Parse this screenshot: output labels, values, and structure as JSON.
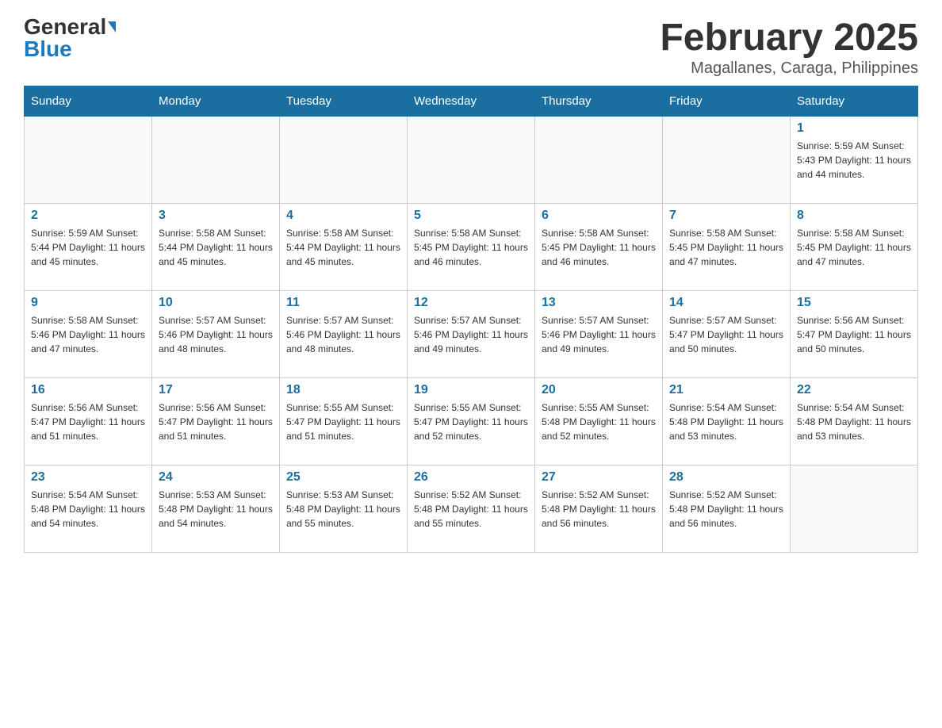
{
  "logo": {
    "general": "General",
    "blue": "Blue"
  },
  "title": {
    "month": "February 2025",
    "location": "Magallanes, Caraga, Philippines"
  },
  "headers": [
    "Sunday",
    "Monday",
    "Tuesday",
    "Wednesday",
    "Thursday",
    "Friday",
    "Saturday"
  ],
  "weeks": [
    [
      {
        "day": "",
        "info": ""
      },
      {
        "day": "",
        "info": ""
      },
      {
        "day": "",
        "info": ""
      },
      {
        "day": "",
        "info": ""
      },
      {
        "day": "",
        "info": ""
      },
      {
        "day": "",
        "info": ""
      },
      {
        "day": "1",
        "info": "Sunrise: 5:59 AM\nSunset: 5:43 PM\nDaylight: 11 hours and 44 minutes."
      }
    ],
    [
      {
        "day": "2",
        "info": "Sunrise: 5:59 AM\nSunset: 5:44 PM\nDaylight: 11 hours and 45 minutes."
      },
      {
        "day": "3",
        "info": "Sunrise: 5:58 AM\nSunset: 5:44 PM\nDaylight: 11 hours and 45 minutes."
      },
      {
        "day": "4",
        "info": "Sunrise: 5:58 AM\nSunset: 5:44 PM\nDaylight: 11 hours and 45 minutes."
      },
      {
        "day": "5",
        "info": "Sunrise: 5:58 AM\nSunset: 5:45 PM\nDaylight: 11 hours and 46 minutes."
      },
      {
        "day": "6",
        "info": "Sunrise: 5:58 AM\nSunset: 5:45 PM\nDaylight: 11 hours and 46 minutes."
      },
      {
        "day": "7",
        "info": "Sunrise: 5:58 AM\nSunset: 5:45 PM\nDaylight: 11 hours and 47 minutes."
      },
      {
        "day": "8",
        "info": "Sunrise: 5:58 AM\nSunset: 5:45 PM\nDaylight: 11 hours and 47 minutes."
      }
    ],
    [
      {
        "day": "9",
        "info": "Sunrise: 5:58 AM\nSunset: 5:46 PM\nDaylight: 11 hours and 47 minutes."
      },
      {
        "day": "10",
        "info": "Sunrise: 5:57 AM\nSunset: 5:46 PM\nDaylight: 11 hours and 48 minutes."
      },
      {
        "day": "11",
        "info": "Sunrise: 5:57 AM\nSunset: 5:46 PM\nDaylight: 11 hours and 48 minutes."
      },
      {
        "day": "12",
        "info": "Sunrise: 5:57 AM\nSunset: 5:46 PM\nDaylight: 11 hours and 49 minutes."
      },
      {
        "day": "13",
        "info": "Sunrise: 5:57 AM\nSunset: 5:46 PM\nDaylight: 11 hours and 49 minutes."
      },
      {
        "day": "14",
        "info": "Sunrise: 5:57 AM\nSunset: 5:47 PM\nDaylight: 11 hours and 50 minutes."
      },
      {
        "day": "15",
        "info": "Sunrise: 5:56 AM\nSunset: 5:47 PM\nDaylight: 11 hours and 50 minutes."
      }
    ],
    [
      {
        "day": "16",
        "info": "Sunrise: 5:56 AM\nSunset: 5:47 PM\nDaylight: 11 hours and 51 minutes."
      },
      {
        "day": "17",
        "info": "Sunrise: 5:56 AM\nSunset: 5:47 PM\nDaylight: 11 hours and 51 minutes."
      },
      {
        "day": "18",
        "info": "Sunrise: 5:55 AM\nSunset: 5:47 PM\nDaylight: 11 hours and 51 minutes."
      },
      {
        "day": "19",
        "info": "Sunrise: 5:55 AM\nSunset: 5:47 PM\nDaylight: 11 hours and 52 minutes."
      },
      {
        "day": "20",
        "info": "Sunrise: 5:55 AM\nSunset: 5:48 PM\nDaylight: 11 hours and 52 minutes."
      },
      {
        "day": "21",
        "info": "Sunrise: 5:54 AM\nSunset: 5:48 PM\nDaylight: 11 hours and 53 minutes."
      },
      {
        "day": "22",
        "info": "Sunrise: 5:54 AM\nSunset: 5:48 PM\nDaylight: 11 hours and 53 minutes."
      }
    ],
    [
      {
        "day": "23",
        "info": "Sunrise: 5:54 AM\nSunset: 5:48 PM\nDaylight: 11 hours and 54 minutes."
      },
      {
        "day": "24",
        "info": "Sunrise: 5:53 AM\nSunset: 5:48 PM\nDaylight: 11 hours and 54 minutes."
      },
      {
        "day": "25",
        "info": "Sunrise: 5:53 AM\nSunset: 5:48 PM\nDaylight: 11 hours and 55 minutes."
      },
      {
        "day": "26",
        "info": "Sunrise: 5:52 AM\nSunset: 5:48 PM\nDaylight: 11 hours and 55 minutes."
      },
      {
        "day": "27",
        "info": "Sunrise: 5:52 AM\nSunset: 5:48 PM\nDaylight: 11 hours and 56 minutes."
      },
      {
        "day": "28",
        "info": "Sunrise: 5:52 AM\nSunset: 5:48 PM\nDaylight: 11 hours and 56 minutes."
      },
      {
        "day": "",
        "info": ""
      }
    ]
  ]
}
